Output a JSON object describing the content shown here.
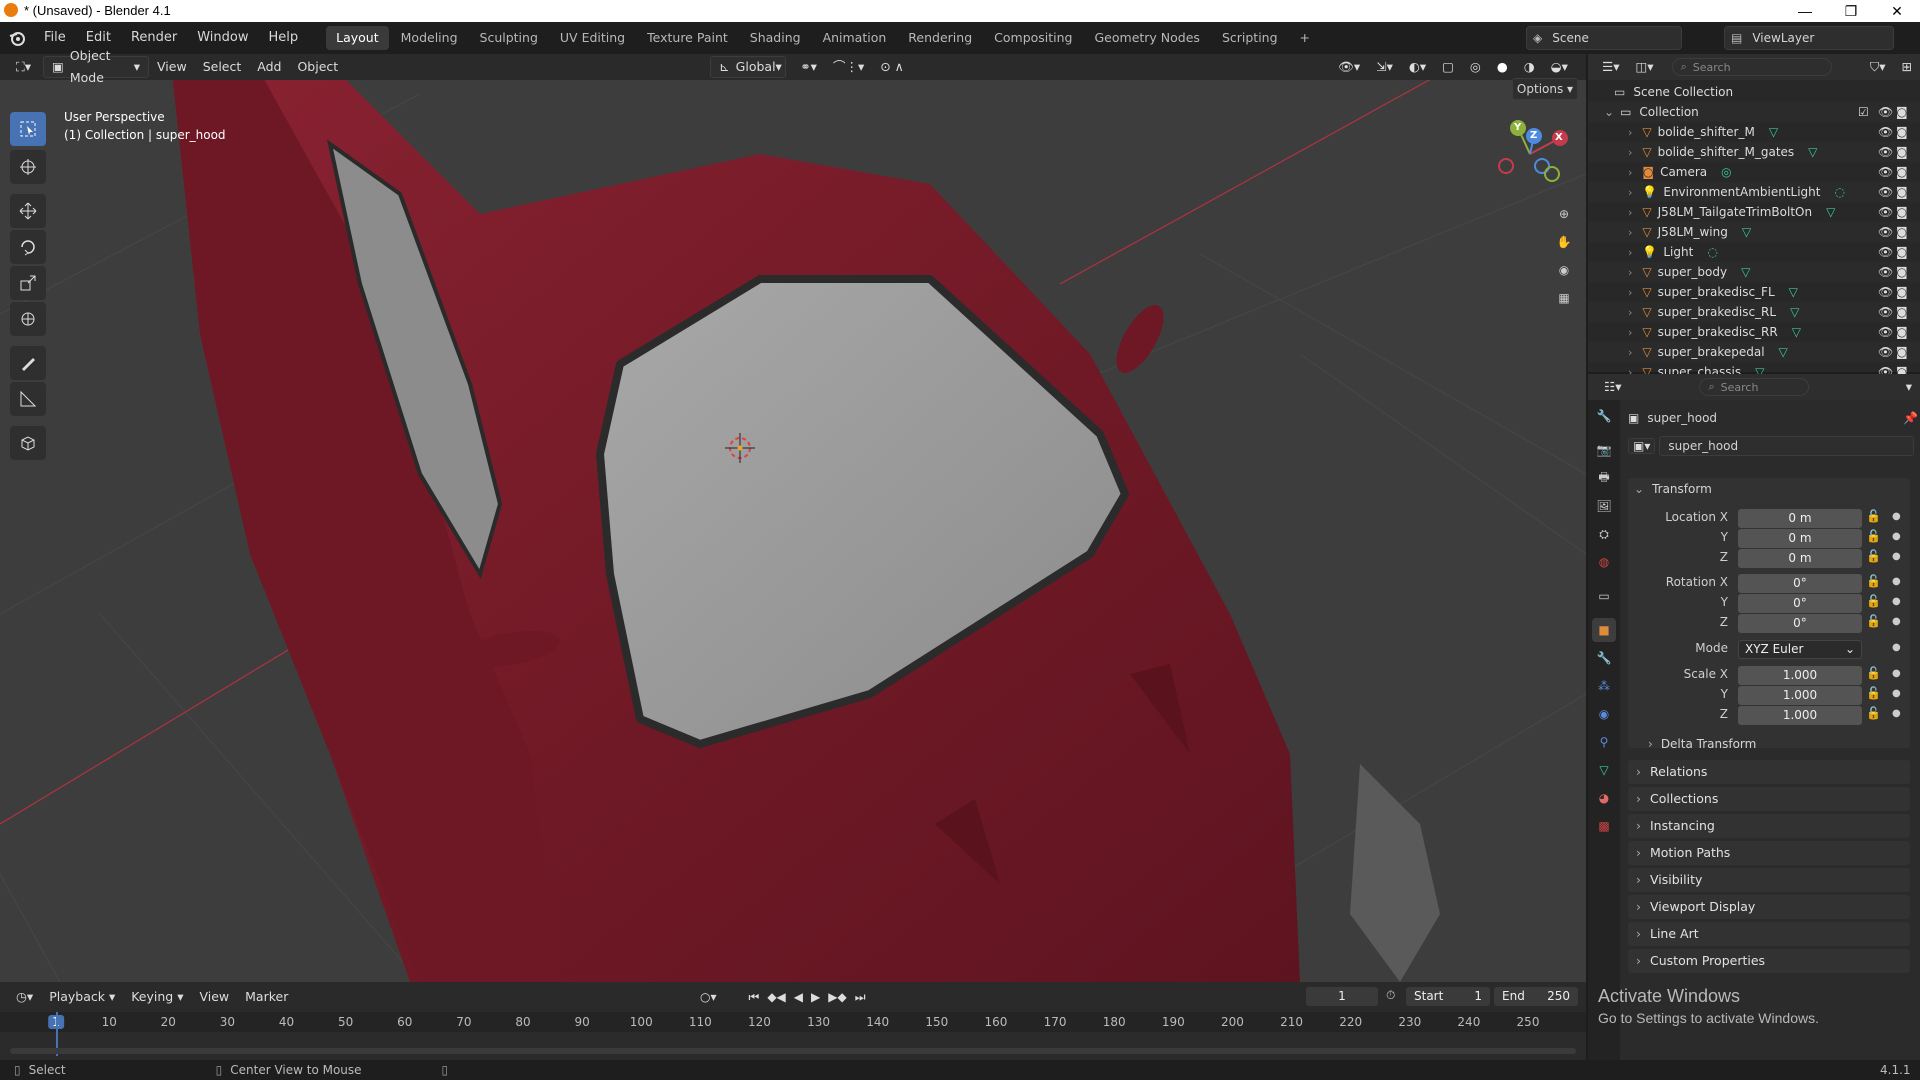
{
  "window": {
    "title": "* (Unsaved) - Blender 4.1",
    "minimize": "—",
    "maximize": "❐",
    "close": "✕"
  },
  "menu": [
    "File",
    "Edit",
    "Render",
    "Window",
    "Help"
  ],
  "workspaces": [
    "Layout",
    "Modeling",
    "Sculpting",
    "UV Editing",
    "Texture Paint",
    "Shading",
    "Animation",
    "Rendering",
    "Compositing",
    "Geometry Nodes",
    "Scripting"
  ],
  "active_workspace": "Layout",
  "add_workspace": "+",
  "scene": {
    "label": "Scene",
    "view_layer": "ViewLayer"
  },
  "viewport_header": {
    "mode": "Object Mode",
    "view": "View",
    "select": "Select",
    "add": "Add",
    "object": "Object",
    "orientation": "Global",
    "options": "Options"
  },
  "viewport": {
    "perspective": "User Perspective",
    "collection_info": "(1) Collection | super_hood"
  },
  "gizmo": {
    "x": "X",
    "y": "Y",
    "z": "Z"
  },
  "outliner": {
    "search_placeholder": "Search",
    "scene_collection": "Scene Collection",
    "collection": "Collection",
    "items": [
      {
        "name": "bolide_shifter_M",
        "type": "mesh"
      },
      {
        "name": "bolide_shifter_M_gates",
        "type": "mesh"
      },
      {
        "name": "Camera",
        "type": "camera"
      },
      {
        "name": "EnvironmentAmbientLight",
        "type": "light"
      },
      {
        "name": "J58LM_TailgateTrimBoltOn",
        "type": "mesh"
      },
      {
        "name": "J58LM_wing",
        "type": "mesh"
      },
      {
        "name": "Light",
        "type": "light"
      },
      {
        "name": "super_body",
        "type": "mesh"
      },
      {
        "name": "super_brakedisc_FL",
        "type": "mesh"
      },
      {
        "name": "super_brakedisc_RL",
        "type": "mesh"
      },
      {
        "name": "super_brakedisc_RR",
        "type": "mesh"
      },
      {
        "name": "super_brakepedal",
        "type": "mesh"
      },
      {
        "name": "super_chassis",
        "type": "mesh"
      }
    ]
  },
  "properties": {
    "search_placeholder": "Search",
    "object_name": "super_hood",
    "datablock": "super_hood",
    "transform_title": "Transform",
    "location": {
      "label_x": "Location X",
      "label_y": "Y",
      "label_z": "Z",
      "x": "0 m",
      "y": "0 m",
      "z": "0 m"
    },
    "rotation": {
      "label_x": "Rotation X",
      "label_y": "Y",
      "label_z": "Z",
      "x": "0°",
      "y": "0°",
      "z": "0°"
    },
    "mode": {
      "label": "Mode",
      "value": "XYZ Euler"
    },
    "scale": {
      "label_x": "Scale X",
      "label_y": "Y",
      "label_z": "Z",
      "x": "1.000",
      "y": "1.000",
      "z": "1.000"
    },
    "delta_transform": "Delta Transform",
    "panels": [
      "Relations",
      "Collections",
      "Instancing",
      "Motion Paths",
      "Visibility",
      "Viewport Display",
      "Line Art",
      "Custom Properties"
    ]
  },
  "timeline": {
    "playback": "Playback",
    "keying": "Keying",
    "view": "View",
    "marker": "Marker",
    "current_frame": "1",
    "start_label": "Start",
    "start": "1",
    "end_label": "End",
    "end": "250",
    "ticks": [
      "1",
      "10",
      "20",
      "30",
      "40",
      "50",
      "60",
      "70",
      "80",
      "90",
      "100",
      "110",
      "120",
      "130",
      "140",
      "150",
      "160",
      "170",
      "180",
      "190",
      "200",
      "210",
      "220",
      "230",
      "240",
      "250"
    ]
  },
  "statusbar": {
    "select": "Select",
    "center_view": "Center View to Mouse",
    "version": "4.1.1"
  },
  "watermark": {
    "line1": "Activate Windows",
    "line2": "Go to Settings to activate Windows."
  },
  "colors": {
    "accent": "#4772b3",
    "car_red": "#7a1c28",
    "x_axis": "#c33c4c",
    "y_axis": "#8cb13b",
    "z_axis": "#4e8ae0",
    "outliner_mesh": "#e08a3c",
    "data_green": "#38c997"
  }
}
